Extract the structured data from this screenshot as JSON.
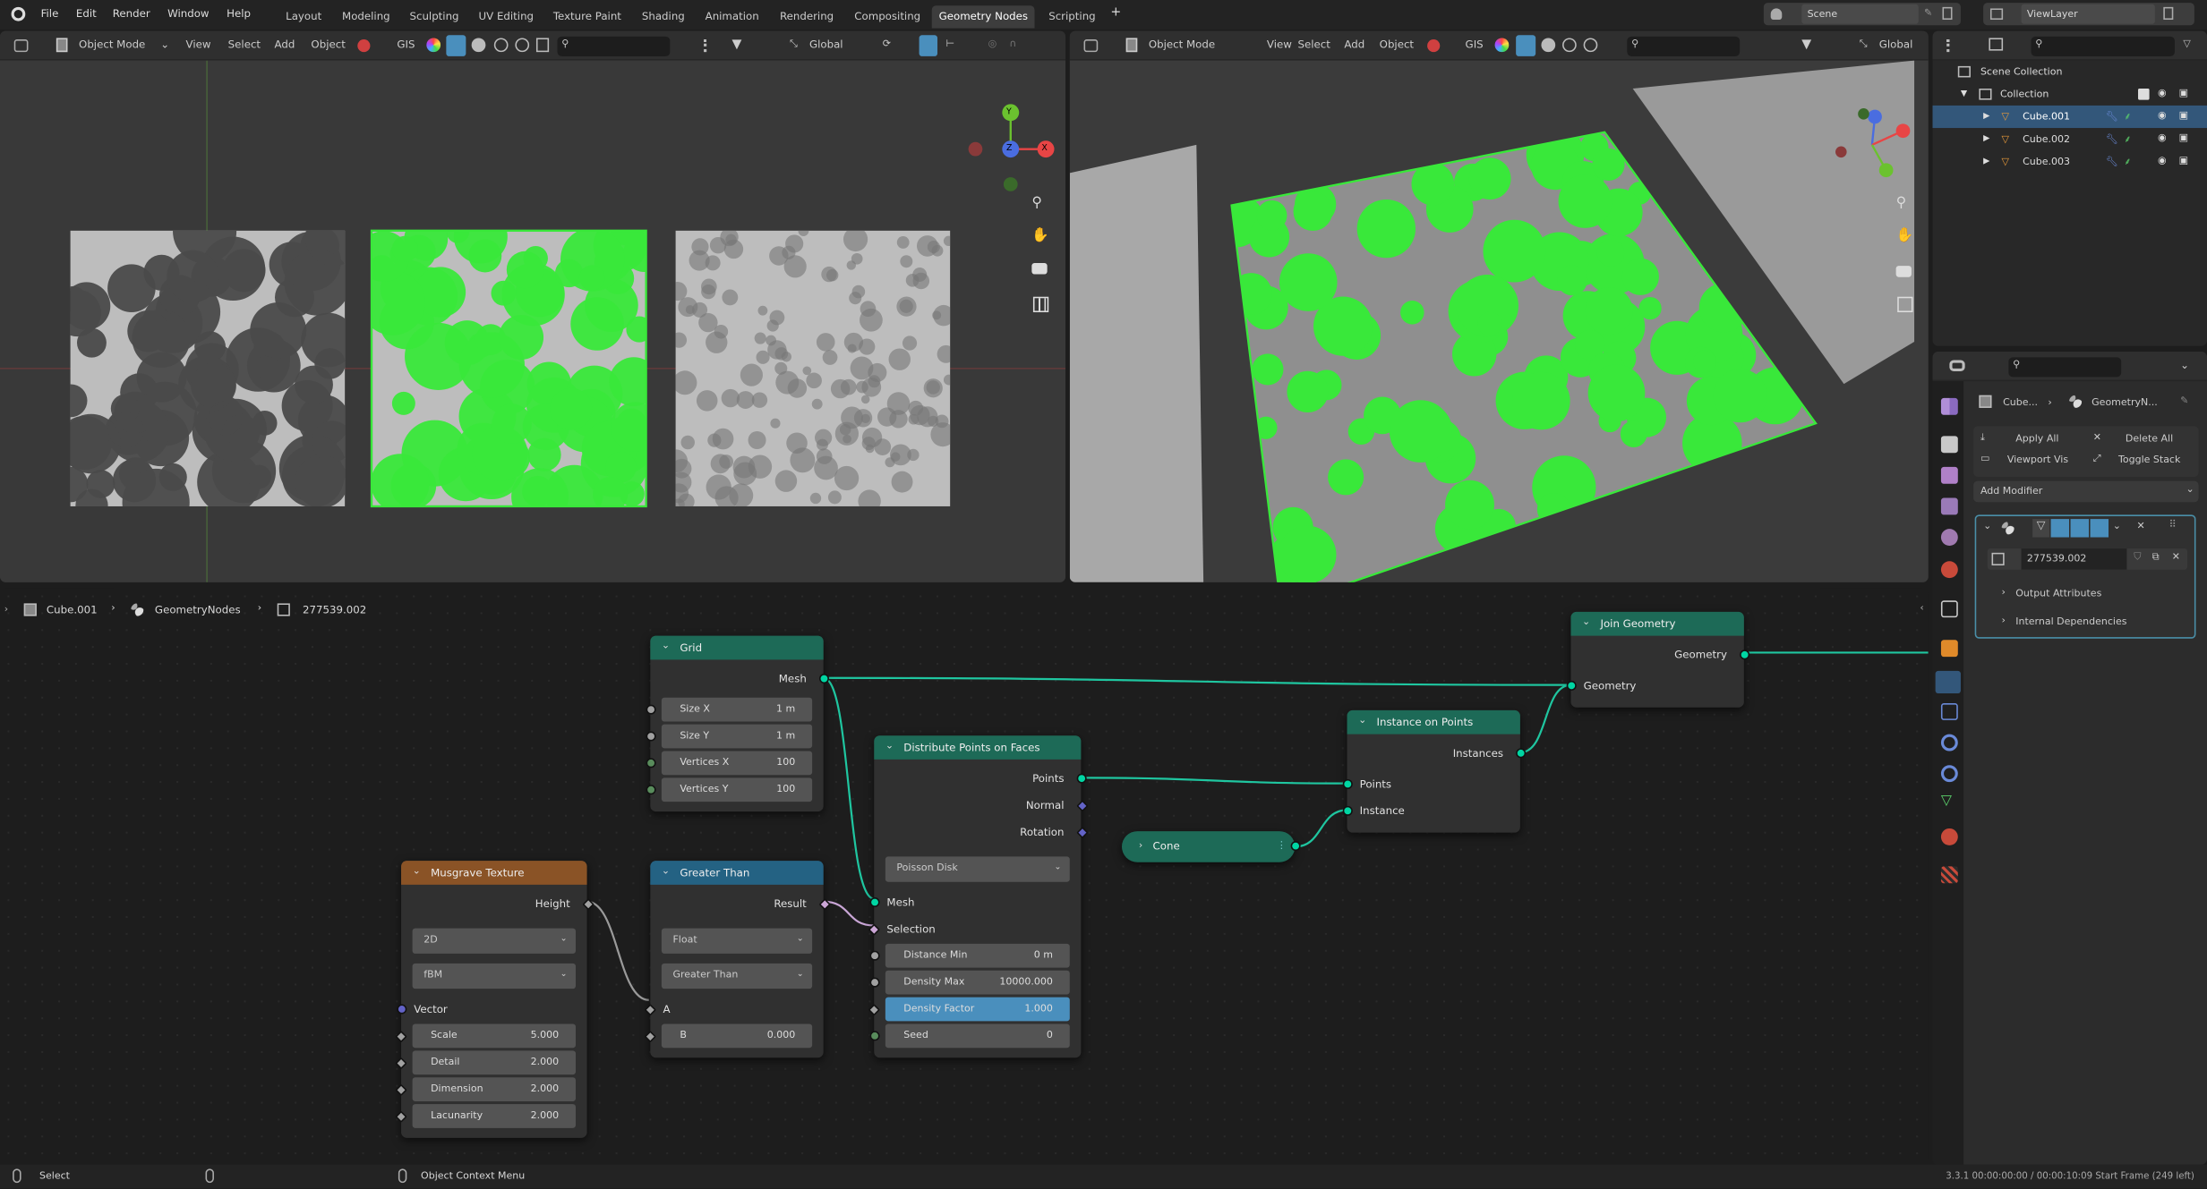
{
  "topbar": {
    "menus": [
      "File",
      "Edit",
      "Render",
      "Window",
      "Help"
    ],
    "workspaces": [
      "Layout",
      "Modeling",
      "Sculpting",
      "UV Editing",
      "Texture Paint",
      "Shading",
      "Animation",
      "Rendering",
      "Compositing",
      "Geometry Nodes",
      "Scripting"
    ],
    "active_workspace": "Geometry Nodes",
    "add_workspace": "+",
    "scene": "Scene",
    "view_layer": "ViewLayer"
  },
  "viewport_header": {
    "mode": "Object Mode",
    "menus": [
      "View",
      "Select",
      "Add",
      "Object"
    ],
    "gis": "GIS",
    "orientation": "Global"
  },
  "gizmo": {
    "x": "X",
    "y": "Y",
    "z": "Z",
    "x_color": "#e84545",
    "y_color": "#6bc22f",
    "z_color": "#4a6de0"
  },
  "selection_color": "#39e83a",
  "outliner": {
    "items": [
      {
        "label": "Scene Collection"
      },
      {
        "label": "Collection"
      },
      {
        "label": "Cube.001",
        "selected": true
      },
      {
        "label": "Cube.002"
      },
      {
        "label": "Cube.003"
      }
    ]
  },
  "properties": {
    "breadcrumb": [
      "Cube...",
      "GeometryN..."
    ],
    "apply_all": "Apply All",
    "delete_all": "Delete All",
    "viewport_vis": "Viewport Vis",
    "toggle_stack": "Toggle Stack",
    "add_modifier": "Add Modifier",
    "node_group": "277539.002",
    "panels": [
      "Output Attributes",
      "Internal Dependencies"
    ]
  },
  "node_editor": {
    "breadcrumb": [
      "Cube.001",
      "GeometryNodes",
      "277539.002"
    ]
  },
  "nodes": {
    "grid": {
      "title": "Grid",
      "color": "#1d6a57",
      "rows": [
        {
          "t": "out",
          "label": "Mesh",
          "sock": "geometry"
        },
        {
          "t": "field",
          "label": "Size X",
          "value": "1 m",
          "sock": "float"
        },
        {
          "t": "field",
          "label": "Size Y",
          "value": "1 m",
          "sock": "float"
        },
        {
          "t": "field",
          "label": "Vertices X",
          "value": "100",
          "sock": "int"
        },
        {
          "t": "field",
          "label": "Vertices Y",
          "value": "100",
          "sock": "int"
        }
      ]
    },
    "musgrave": {
      "title": "Musgrave Texture",
      "color": "#8a5326",
      "rows": [
        {
          "t": "out",
          "label": "Height",
          "sock": "float-field"
        },
        {
          "t": "drop",
          "label": "2D"
        },
        {
          "t": "drop",
          "label": "fBM"
        },
        {
          "t": "in",
          "label": "Vector",
          "sock": "vector"
        },
        {
          "t": "field",
          "label": "Scale",
          "value": "5.000",
          "sock": "float-field"
        },
        {
          "t": "field",
          "label": "Detail",
          "value": "2.000",
          "sock": "float-field"
        },
        {
          "t": "field",
          "label": "Dimension",
          "value": "2.000",
          "sock": "float-field"
        },
        {
          "t": "field",
          "label": "Lacunarity",
          "value": "2.000",
          "sock": "float-field"
        }
      ]
    },
    "greater": {
      "title": "Greater Than",
      "color": "#246283",
      "rows": [
        {
          "t": "out",
          "label": "Result",
          "sock": "bool-field"
        },
        {
          "t": "drop",
          "label": "Float"
        },
        {
          "t": "drop",
          "label": "Greater Than"
        },
        {
          "t": "in",
          "label": "A",
          "sock": "float-field"
        },
        {
          "t": "field",
          "label": "B",
          "value": "0.000",
          "sock": "float-field"
        }
      ]
    },
    "distribute": {
      "title": "Distribute Points on Faces",
      "color": "#1d6a57",
      "rows": [
        {
          "t": "out",
          "label": "Points",
          "sock": "geometry"
        },
        {
          "t": "out",
          "label": "Normal",
          "sock": "vector-field"
        },
        {
          "t": "out",
          "label": "Rotation",
          "sock": "vector-field"
        },
        {
          "t": "drop",
          "label": "Poisson Disk"
        },
        {
          "t": "in",
          "label": "Mesh",
          "sock": "geometry"
        },
        {
          "t": "in",
          "label": "Selection",
          "sock": "bool-field"
        },
        {
          "t": "field",
          "label": "Distance Min",
          "value": "0 m",
          "sock": "float"
        },
        {
          "t": "field",
          "label": "Density Max",
          "value": "10000.000",
          "sock": "float"
        },
        {
          "t": "field",
          "label": "Density Factor",
          "value": "1.000",
          "sock": "float-field",
          "highlight": true
        },
        {
          "t": "field",
          "label": "Seed",
          "value": "0",
          "sock": "int"
        }
      ]
    },
    "instance": {
      "title": "Instance on Points",
      "color": "#1d6a57",
      "rows": [
        {
          "t": "out",
          "label": "Instances",
          "sock": "geometry"
        },
        {
          "t": "in",
          "label": "Points",
          "sock": "geometry"
        },
        {
          "t": "in",
          "label": "Instance",
          "sock": "geometry"
        }
      ]
    },
    "join": {
      "title": "Join Geometry",
      "color": "#1d6a57",
      "rows": [
        {
          "t": "out",
          "label": "Geometry",
          "sock": "geometry"
        },
        {
          "t": "in",
          "label": "Geometry",
          "sock": "geometry"
        }
      ]
    },
    "cone": {
      "title": "Cone"
    }
  },
  "statusbar": {
    "select": "Select",
    "context_menu": "Object Context Menu",
    "info": "3.3.1  00:00:00:00 / 00:00:10:09  Start Frame (249 left)"
  }
}
